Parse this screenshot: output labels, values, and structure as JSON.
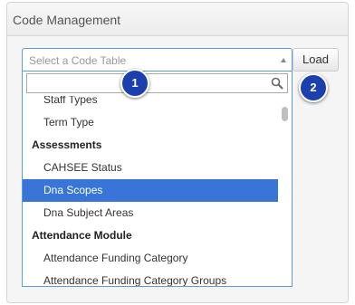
{
  "panel": {
    "title": "Code Management"
  },
  "select": {
    "placeholder": "Select a Code Table",
    "search_value": ""
  },
  "dropdown": {
    "items": [
      {
        "kind": "option",
        "label": "Staff Types"
      },
      {
        "kind": "option",
        "label": "Term Type"
      },
      {
        "kind": "group",
        "label": "Assessments"
      },
      {
        "kind": "option",
        "label": "CAHSEE Status"
      },
      {
        "kind": "option",
        "label": "Dna Scopes",
        "highlighted": true
      },
      {
        "kind": "option",
        "label": "Dna Subject Areas"
      },
      {
        "kind": "group",
        "label": "Attendance Module"
      },
      {
        "kind": "option",
        "label": "Attendance Funding Category"
      },
      {
        "kind": "option",
        "label": "Attendance Funding Category Groups"
      }
    ]
  },
  "load_button": {
    "label": "Load"
  },
  "badges": {
    "one": "1",
    "two": "2"
  },
  "colors": {
    "highlight": "#3875d7",
    "badge": "#1c3fae",
    "focus_border": "#5b9dd9"
  }
}
